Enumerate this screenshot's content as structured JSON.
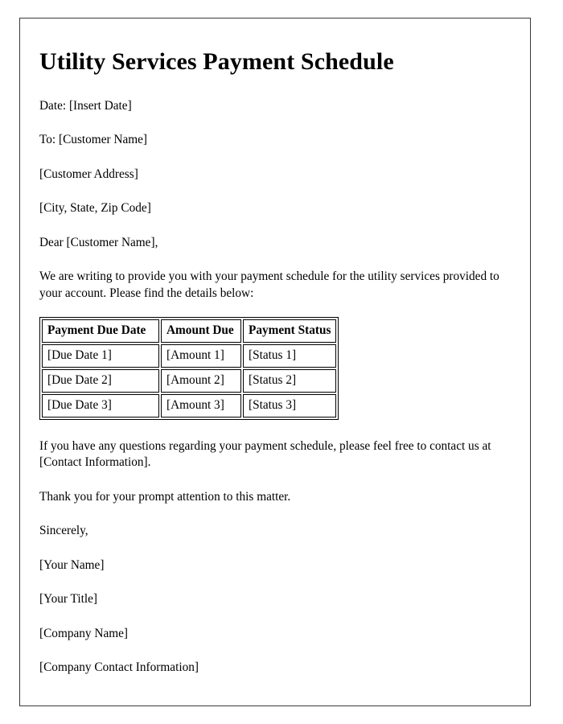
{
  "document": {
    "title": "Utility Services Payment Schedule",
    "date_line": "Date: [Insert Date]",
    "recipient_line": "To: [Customer Name]",
    "address_line": "[Customer Address]",
    "city_state_zip_line": "[City, State, Zip Code]",
    "salutation": "Dear [Customer Name],",
    "intro_paragraph": "We are writing to provide you with your payment schedule for the utility services provided to your account. Please find the details below:",
    "closing_paragraph": "If you have any questions regarding your payment schedule, please feel free to contact us at [Contact Information].",
    "thanks_paragraph": "Thank you for your prompt attention to this matter.",
    "signoff": "Sincerely,",
    "signature": {
      "name": "[Your Name]",
      "title": "[Your Title]",
      "company": "[Company Name]",
      "company_contact": "[Company Contact Information]"
    }
  },
  "schedule_table": {
    "headers": [
      "Payment Due Date",
      "Amount Due",
      "Payment Status"
    ],
    "rows": [
      [
        "[Due Date 1]",
        "[Amount 1]",
        "[Status 1]"
      ],
      [
        "[Due Date 2]",
        "[Amount 2]",
        "[Status 2]"
      ],
      [
        "[Due Date 3]",
        "[Amount 3]",
        "[Status 3]"
      ]
    ]
  },
  "colors": {
    "page_border": "#3a3a3a",
    "text": "#000000",
    "table_border": "#000000",
    "background": "#ffffff"
  }
}
